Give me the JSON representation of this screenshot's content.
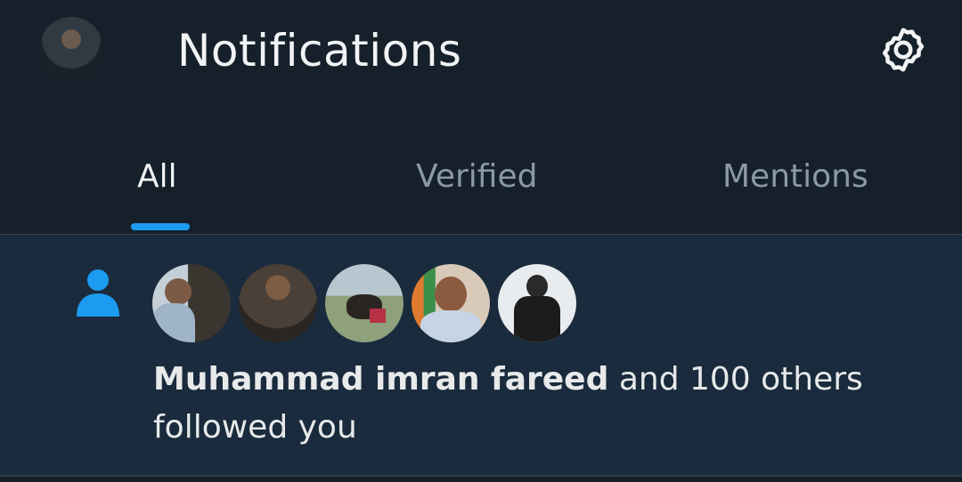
{
  "header": {
    "title": "Notifications",
    "avatar_icon": "profile-avatar",
    "settings_icon": "gear-icon"
  },
  "tabs": [
    {
      "label": "All",
      "active": true
    },
    {
      "label": "Verified",
      "active": false
    },
    {
      "label": "Mentions",
      "active": false
    }
  ],
  "notification": {
    "icon": "person-icon",
    "name": "Muhammad imran fareed",
    "text_after_name": " and 100 others",
    "text_second_line": "followed you",
    "avatar_count_shown": 5
  },
  "colors": {
    "background": "#15202b",
    "accent": "#1d9bf0",
    "unread_background": "#192b3c"
  }
}
